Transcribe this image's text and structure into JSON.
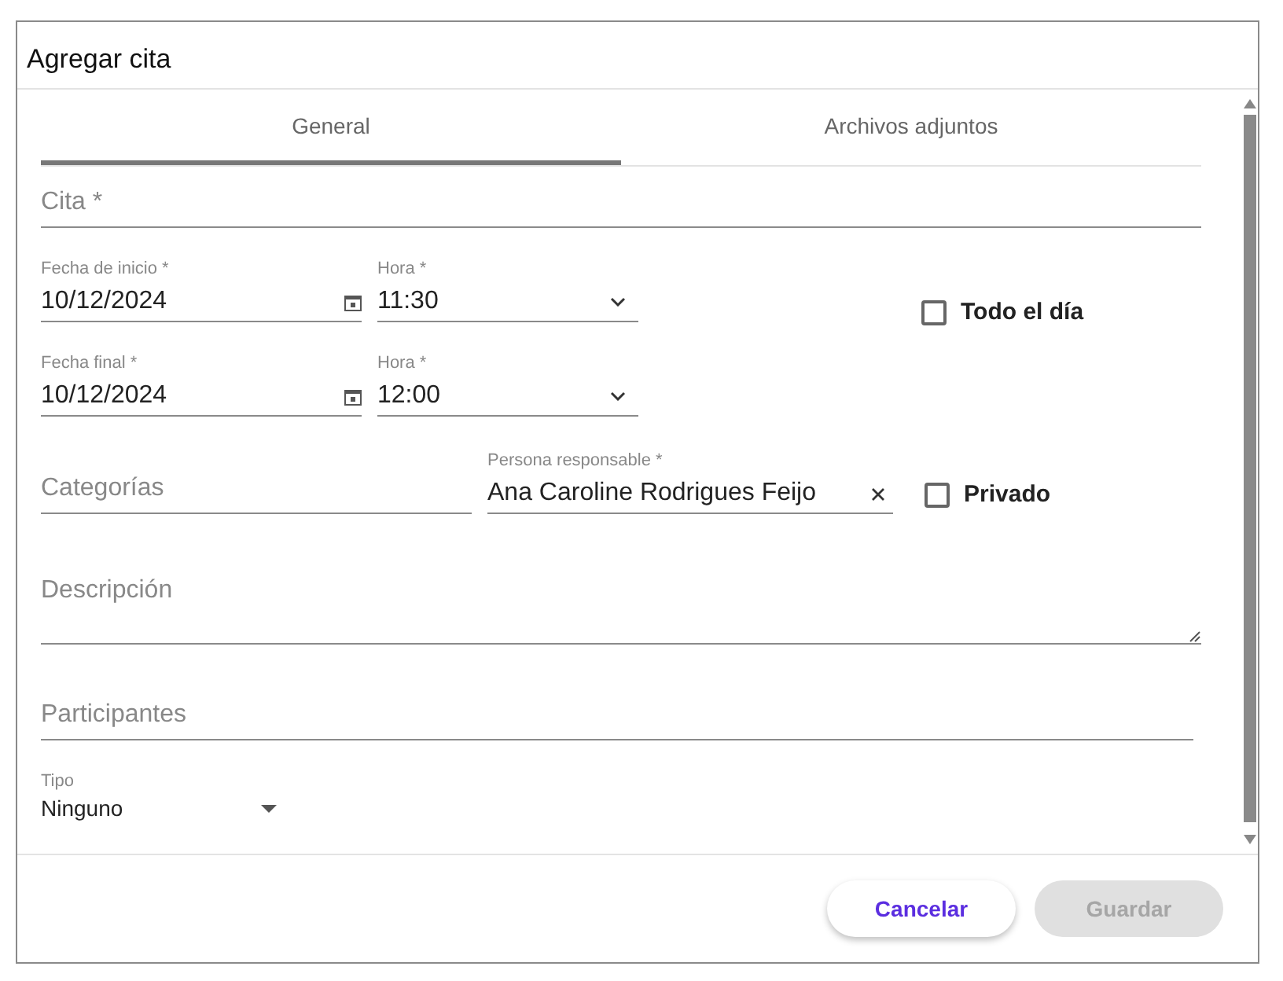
{
  "dialog": {
    "title": "Agregar cita"
  },
  "tabs": [
    {
      "label": "General",
      "selected": true
    },
    {
      "label": "Archivos adjuntos",
      "selected": false
    }
  ],
  "cita": {
    "placeholder": "Cita *"
  },
  "start": {
    "date_label": "Fecha de inicio *",
    "date": "10/12/2024",
    "time_label": "Hora *",
    "time": "11:30"
  },
  "all_day": {
    "label": "Todo el día",
    "checked": false
  },
  "end": {
    "date_label": "Fecha final *",
    "date": "10/12/2024",
    "time_label": "Hora *",
    "time": "12:00"
  },
  "categories": {
    "placeholder": "Categorías"
  },
  "responsible": {
    "label": "Persona responsable *",
    "value": "Ana Caroline Rodrigues Feijo"
  },
  "private": {
    "label": "Privado",
    "checked": false
  },
  "description": {
    "placeholder": "Descripción"
  },
  "participants": {
    "placeholder": "Participantes"
  },
  "type": {
    "label": "Tipo",
    "value": "Ninguno"
  },
  "buttons": [
    {
      "label": "Cancelar",
      "disabled": false
    },
    {
      "label": "Guardar",
      "disabled": true
    }
  ]
}
